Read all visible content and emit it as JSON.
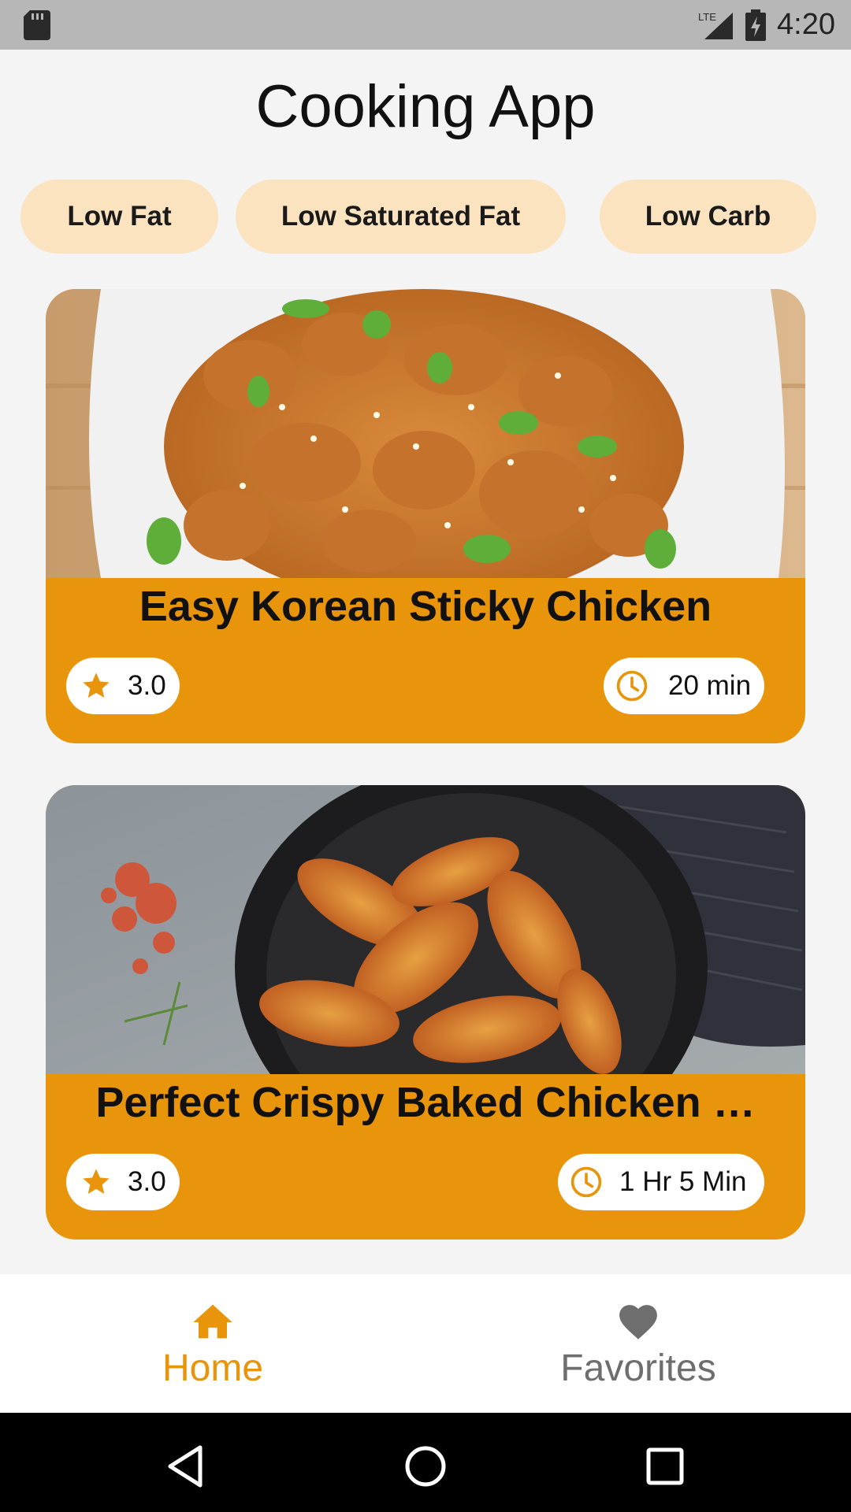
{
  "status_bar": {
    "network": "LTE",
    "time": "4:20",
    "icons": [
      "sd-card-icon",
      "lte-signal-icon",
      "battery-charging-icon"
    ]
  },
  "app_title": "Cooking App",
  "filters": [
    {
      "label": "Low Fat"
    },
    {
      "label": "Low Saturated Fat"
    },
    {
      "label": "Low Carb"
    }
  ],
  "recipes": [
    {
      "title": "Easy Korean Sticky Chicken",
      "rating": "3.0",
      "time": "20 min",
      "image": "sticky-chicken-photo"
    },
    {
      "title": "Perfect Crispy Baked Chicken …",
      "rating": "3.0",
      "time": "1 Hr 5 Min",
      "image": "baked-chicken-wings-photo"
    }
  ],
  "bottom_nav": {
    "items": [
      {
        "label": "Home",
        "icon": "home-icon",
        "active": true
      },
      {
        "label": "Favorites",
        "icon": "heart-icon",
        "active": false
      }
    ]
  },
  "colors": {
    "accent": "#e8950c",
    "chip_bg": "#fbe3c0",
    "nav_inactive": "#6e6e6e",
    "background": "#f4f4f5"
  },
  "system_nav": {
    "icons": [
      "back-icon",
      "home-circle-icon",
      "recents-icon"
    ]
  }
}
